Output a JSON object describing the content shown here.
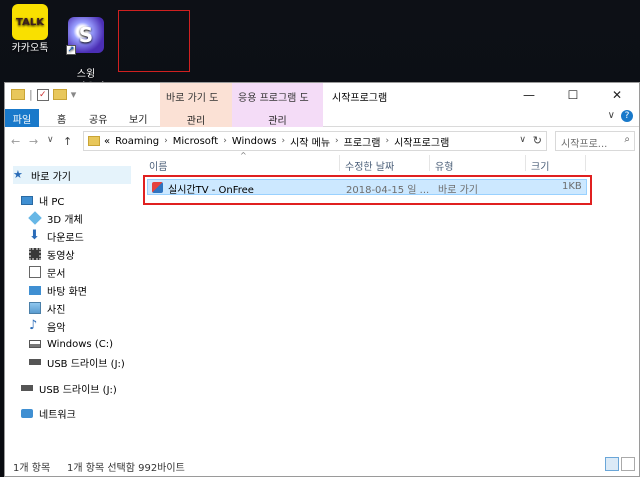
{
  "desktop": {
    "icons": [
      {
        "label": "카카오톡",
        "badge": "TALK",
        "icon": "kakaotalk-icon"
      },
      {
        "label": "스윙\n브라우저",
        "badge": "S",
        "icon": "swing-browser-icon"
      }
    ]
  },
  "window": {
    "title": "시작프로그램",
    "context_tabs": [
      "바로 가기 도구",
      "응용 프로그램 도구"
    ],
    "controls": {
      "minimize": "—",
      "maximize": "☐",
      "close": "✕"
    }
  },
  "ribbon": {
    "tabs": [
      "파일",
      "홈",
      "공유",
      "보기"
    ],
    "context_labels": [
      "관리",
      "관리"
    ],
    "help": "?",
    "collapse": "∨"
  },
  "nav": {
    "back": "←",
    "forward": "→",
    "dropdown": "∨",
    "up": "↑"
  },
  "address": {
    "prefix": "«",
    "crumbs": [
      "Roaming",
      "Microsoft",
      "Windows",
      "시작 메뉴",
      "프로그램",
      "시작프로그램"
    ],
    "dropdown": "∨",
    "refresh": "↻"
  },
  "search": {
    "placeholder": "시작프로...",
    "icon": "⌕"
  },
  "navpane": {
    "items": [
      {
        "label": "바로 가기",
        "icon": "star-icon",
        "selected": true
      },
      {
        "label": "내 PC",
        "icon": "pc-icon"
      },
      {
        "label": "3D 개체",
        "icon": "cube-icon"
      },
      {
        "label": "다운로드",
        "icon": "download-icon"
      },
      {
        "label": "동영상",
        "icon": "video-icon"
      },
      {
        "label": "문서",
        "icon": "document-icon"
      },
      {
        "label": "바탕 화면",
        "icon": "desktop-icon"
      },
      {
        "label": "사진",
        "icon": "picture-icon"
      },
      {
        "label": "음악",
        "icon": "music-icon"
      },
      {
        "label": "Windows (C:)",
        "icon": "drive-icon"
      },
      {
        "label": "USB 드라이브 (J:)",
        "icon": "usb-drive-icon"
      },
      {
        "label": "USB 드라이브 (J:)",
        "icon": "usb-drive-icon"
      },
      {
        "label": "네트워크",
        "icon": "network-icon"
      }
    ]
  },
  "columns": [
    "이름",
    "수정한 날짜",
    "유형",
    "크기"
  ],
  "files": [
    {
      "name": "실시간TV - OnFree",
      "date": "2018-04-15 일 ...",
      "type": "바로 가기",
      "size": "1KB"
    }
  ],
  "status": {
    "count": "1개 항목",
    "selection": "1개 항목 선택함 992바이트"
  },
  "colors": {
    "accent": "#1979ca",
    "selection": "#cce8ff",
    "highlight_outline": "#e02020"
  }
}
